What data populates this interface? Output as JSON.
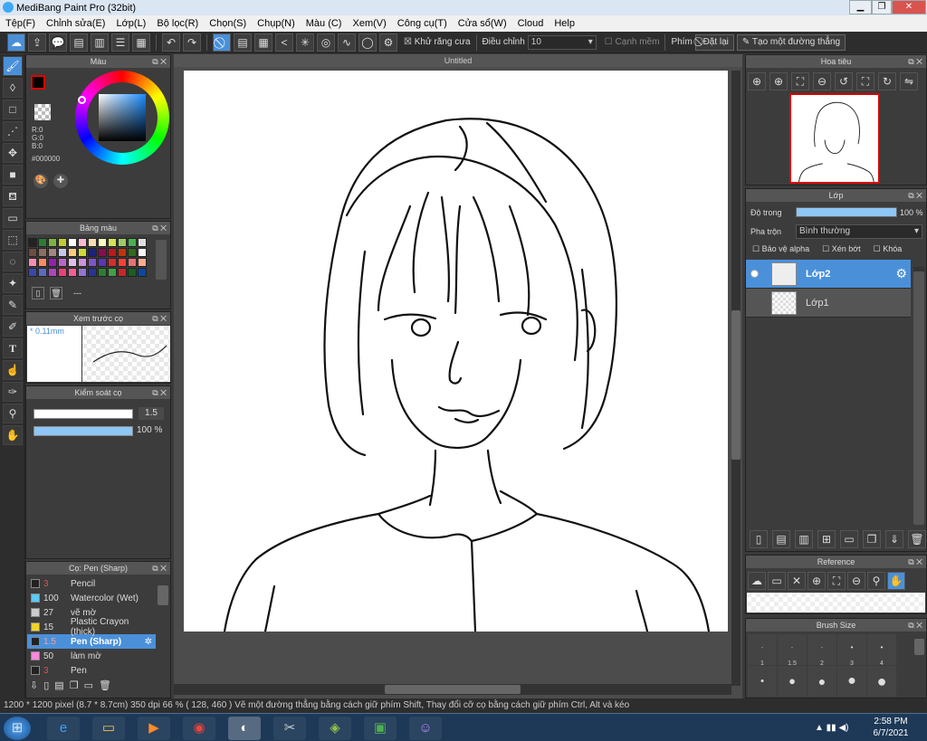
{
  "app": {
    "title": "MediBang Paint Pro (32bit)"
  },
  "menu": [
    "Tệp(F)",
    "Chỉnh sửa(E)",
    "Lớp(L)",
    "Bộ lọc(R)",
    "Chọn(S)",
    "Chụp(N)",
    "Màu (C)",
    "Xem(V)",
    "Công cụ(T)",
    "Cửa sổ(W)",
    "Cloud",
    "Help"
  ],
  "toolbar": {
    "antialias_label": "Khử răng cưa",
    "adjust_label": "Điều chỉnh",
    "adjust_value": "10",
    "edge_label": "Cạnh mềm",
    "key_label": "Phím",
    "reset_label": "Đặt lại",
    "straight_label": "Tạo một đường thẳng"
  },
  "color_panel": {
    "title": "Màu",
    "r": "R:0",
    "g": "G:0",
    "b": "B:0",
    "hex": "#000000",
    "fg": "#000000",
    "bg": "#000000"
  },
  "palette_panel": {
    "title": "Bảng màu",
    "footer": "---",
    "colors": [
      "#222222",
      "#2e7d32",
      "#7cb342",
      "#c0ca33",
      "#ffffff",
      "#f8bbd0",
      "#f5deb3",
      "#fff9c4",
      "#d4e157",
      "#9ccc65",
      "#4caf50",
      "#e0e0e0",
      "#6d4c41",
      "#8d6e63",
      "#a1887f",
      "#c5cae9",
      "#ffcc80",
      "#cddc39",
      "#1a237e",
      "#880e4f",
      "#b71c1c",
      "#bf360c",
      "#33691e",
      "#fafafa",
      "#f48fb1",
      "#ff8a65",
      "#8e24aa",
      "#ba68c8",
      "#e1bee7",
      "#ce93d8",
      "#7e57c2",
      "#5e35b1",
      "#d32f2f",
      "#f44336",
      "#e57373",
      "#ffab91",
      "#3949ab",
      "#5c6bc0",
      "#ab47bc",
      "#ec407a",
      "#f06292",
      "#9575cd",
      "#283593",
      "#2e7d32",
      "#43a047",
      "#c62828",
      "#1b5e20",
      "#0d47a1"
    ]
  },
  "preview_panel": {
    "title": "Xem trước cọ",
    "size": "* 0.11mm"
  },
  "control_panel": {
    "title": "Kiểm soát cọ",
    "size": "1.5",
    "opacity": "100 %",
    "opacity_fraction": 1.0
  },
  "brush_panel": {
    "title": "Cọ: Pen (Sharp)",
    "items": [
      {
        "size": "3",
        "name": "Pencil",
        "color": "#222222"
      },
      {
        "size": "100",
        "name": "Watercolor (Wet)",
        "color": "#5bc8f5"
      },
      {
        "size": "27",
        "name": "vẽ mờ",
        "color": "#cccccc"
      },
      {
        "size": "15",
        "name": "Plastic Crayon (thick)",
        "color": "#f0d22a"
      },
      {
        "size": "1.5",
        "name": "Pen (Sharp)",
        "color": "#222222"
      },
      {
        "size": "50",
        "name": "làm mờ",
        "color": "#ff88dd"
      },
      {
        "size": "3",
        "name": "Pen",
        "color": "#222222"
      }
    ]
  },
  "canvas": {
    "title": "Untitled"
  },
  "navigator": {
    "title": "Hoa tiêu"
  },
  "layer_panel": {
    "title": "Lớp",
    "opacity_label": "Độ trong",
    "opacity_value": "100 %",
    "opacity_fraction": 1.0,
    "blend_label": "Pha trộn",
    "blend_value": "Bình thường",
    "protect_alpha": "Bảo vệ alpha",
    "clipping": "Xén bớt",
    "lock": "Khóa",
    "layers": [
      {
        "name": "Lớp2"
      },
      {
        "name": "Lớp1"
      }
    ]
  },
  "reference_panel": {
    "title": "Reference"
  },
  "brush_size_panel": {
    "title": "Brush Size",
    "labels": [
      "1",
      "1.5",
      "2",
      "3",
      "4"
    ]
  },
  "status": {
    "text": "1200 * 1200 pixel   (8.7 * 8.7cm)   350 dpi   66 %   ( 128, 460 )   Vẽ một đường thẳng bằng cách giữ phím Shift, Thay đổi cỡ cọ bằng cách giữ phím Ctrl, Alt và kéo"
  },
  "taskbar": {
    "time": "2:58 PM",
    "date": "6/7/2021"
  }
}
